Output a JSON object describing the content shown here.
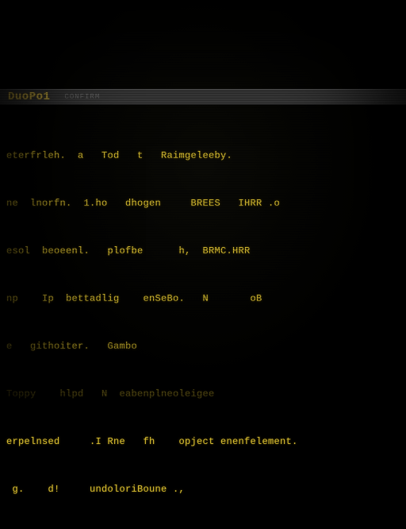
{
  "colors": {
    "bg": "#000000",
    "titlebar_bg": "#3a3a3a",
    "text": "#cdb63a",
    "title": "#d6b84a",
    "subtitle": "#6a6a6a"
  },
  "titlebar": {
    "title": "DuoPo1",
    "subtitle": "CONFIRM"
  },
  "lines": [
    "eterfrleh.  a   Tod   t   Raimgeleeby.",
    "ne  lnorfn.  1.ho   dhogen     BREES   IHRR .o",
    "esol  beoeenl.   plofbe      h,  BRMC.HRR",
    "np    Ip  bettadlig    enSeBo.   N       oB",
    "e   githoiter.   Gambo",
    "Toppy    hlpd   N  eabenplneoleigee",
    "erpelnsed     .I Rne   fh    opject enenfelement.",
    " g.    d!     undoloriBoune .,"
  ]
}
